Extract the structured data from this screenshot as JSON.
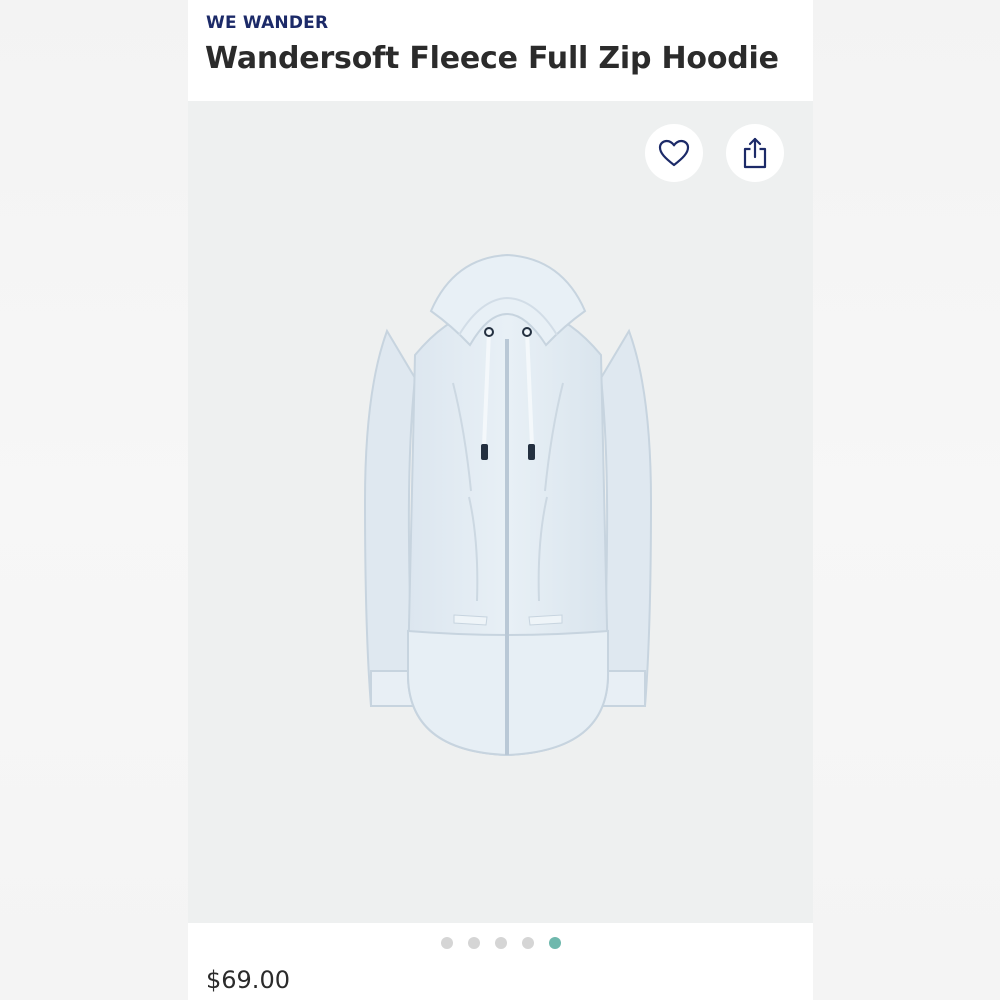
{
  "product": {
    "brand": "WE WANDER",
    "title": "Wandersoft Fleece Full Zip Hoodie",
    "price": "$69.00"
  },
  "actions": {
    "favorite_icon": "heart-icon",
    "share_icon": "share-icon"
  },
  "gallery": {
    "image": "hoodie-product-image",
    "total_images": 5,
    "active_index": 4,
    "dots": [
      "1",
      "2",
      "3",
      "4",
      "5"
    ]
  },
  "colors": {
    "brand": "#1c2a68",
    "title": "#2b2b2b",
    "image_background": "#eef0f0",
    "dot_inactive": "#d5d5d5",
    "dot_active": "#6fb8ad",
    "product": "#e6eef4"
  }
}
